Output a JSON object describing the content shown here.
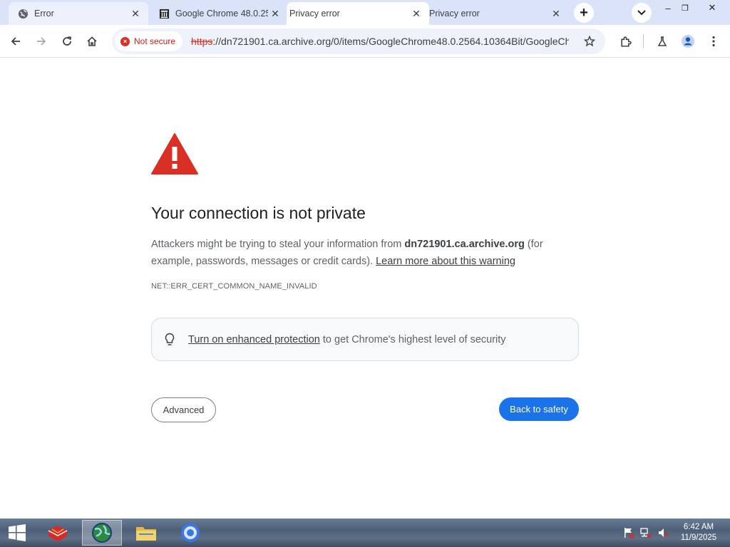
{
  "browser": {
    "tabs": [
      {
        "title": "Error",
        "icon": "globe-icon",
        "state": "inactive"
      },
      {
        "title": "Google Chrome 48.0.25",
        "icon": "archive-org-icon",
        "state": "inactive"
      },
      {
        "title": "Privacy error",
        "icon": "none",
        "state": "active"
      },
      {
        "title": "Privacy error",
        "icon": "none",
        "state": "inactive"
      }
    ],
    "new_tab_label": "+",
    "window_controls": {
      "minimize": "–",
      "restore": "❐",
      "close": "✕"
    }
  },
  "toolbar": {
    "security_chip": "Not secure",
    "url_scheme": "https",
    "url_rest": "://dn721901.ca.archive.org/0/items/GoogleChrome48.0.2564.10364Bit/GoogleCh..."
  },
  "page": {
    "heading": "Your connection is not private",
    "desc_prefix": "Attackers might be trying to steal your information from ",
    "desc_host": "dn721901.ca.archive.org",
    "desc_suffix": " (for example, passwords, messages or credit cards). ",
    "learn_more": "Learn more about this warning",
    "error_code": "NET::ERR_CERT_COMMON_NAME_INVALID",
    "enhanced_link": "Turn on enhanced protection",
    "enhanced_suffix": " to get Chrome's highest level of security",
    "advanced_button": "Advanced",
    "back_button": "Back to safety"
  },
  "taskbar": {
    "time": "6:42 AM",
    "date": "11/9/2025"
  },
  "colors": {
    "tabstrip": "#dae3f8",
    "danger": "#d93025",
    "primary": "#1a73e8"
  }
}
